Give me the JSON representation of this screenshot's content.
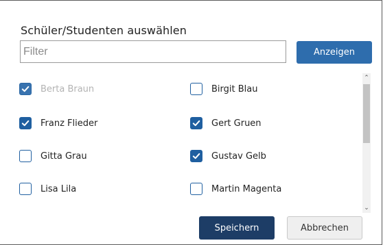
{
  "dialog": {
    "title": "Schüler/Studenten auswählen"
  },
  "filter": {
    "placeholder": "Filter",
    "value": ""
  },
  "buttons": {
    "show_label": "Anzeigen",
    "save_label": "Speichern",
    "cancel_label": "Abbrechen"
  },
  "students": [
    {
      "name": "Berta Braun",
      "checked": true,
      "disabled": true
    },
    {
      "name": "Birgit Blau",
      "checked": false,
      "disabled": false
    },
    {
      "name": "Franz Flieder",
      "checked": true,
      "disabled": false
    },
    {
      "name": "Gert Gruen",
      "checked": true,
      "disabled": false
    },
    {
      "name": "Gitta Grau",
      "checked": false,
      "disabled": false
    },
    {
      "name": "Gustav Gelb",
      "checked": true,
      "disabled": false
    },
    {
      "name": "Lisa Lila",
      "checked": false,
      "disabled": false
    },
    {
      "name": "Martin Magenta",
      "checked": false,
      "disabled": false
    }
  ],
  "colors": {
    "primary": "#2e6dad",
    "save": "#1d3d66",
    "checkbox": "#1f5fa0"
  }
}
